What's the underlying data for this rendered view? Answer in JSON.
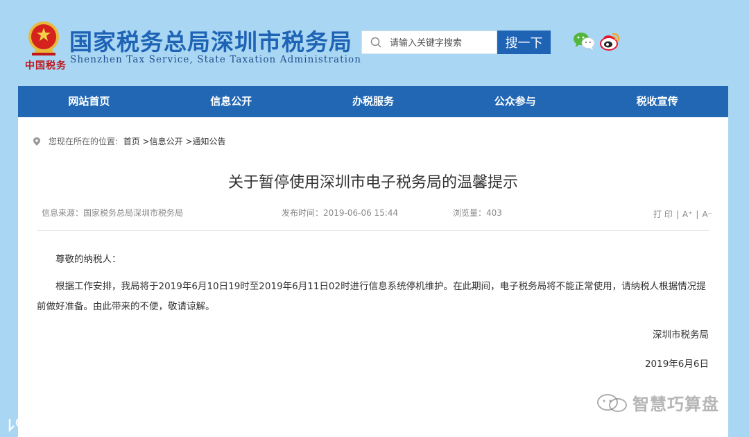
{
  "header": {
    "seal_text": "中国税务",
    "title": "国家税务总局深圳市税务局",
    "subtitle": "Shenzhen Tax Service, State Taxation Administration",
    "search": {
      "placeholder": "请输入关键字搜索",
      "button_label": "搜一下"
    },
    "icons": [
      "emblem-icon",
      "search-icon",
      "wechat-icon",
      "weibo-icon"
    ]
  },
  "nav": {
    "items": [
      {
        "label": "网站首页"
      },
      {
        "label": "信息公开"
      },
      {
        "label": "办税服务"
      },
      {
        "label": "公众参与"
      },
      {
        "label": "税收宣传"
      }
    ]
  },
  "breadcrumb": {
    "prefix": "您现在所在的位置:",
    "items": [
      "首页",
      ">信息公开",
      ">通知公告"
    ]
  },
  "article": {
    "title": "关于暂停使用深圳市电子税务局的温馨提示",
    "source": "信息来源：国家税务总局深圳市税务局",
    "time": "发布时间：2019-06-06 15:44",
    "views": "浏览量：403",
    "tools": {
      "print": "打 印",
      "font_up": "A⁺",
      "font_down": "A⁻"
    },
    "greeting": "尊敬的纳税人：",
    "body": "根据工作安排，我局将于2019年6月10日19时至2019年6月11日02时进行信息系统停机维护。在此期间，电子税务局将不能正常使用，请纳税人根据情况提前做好准备。由此带来的不便，敬请谅解。",
    "signature": "深圳市税务局",
    "date": "2019年6月6日"
  },
  "watermarks": {
    "right": "智慧巧算盘",
    "left": "大数跨境"
  },
  "colors": {
    "background": "#a9d7f3",
    "brand_blue": "#1f63b5",
    "nav_blue": "#2167b4",
    "seal_red": "#c0161c"
  }
}
